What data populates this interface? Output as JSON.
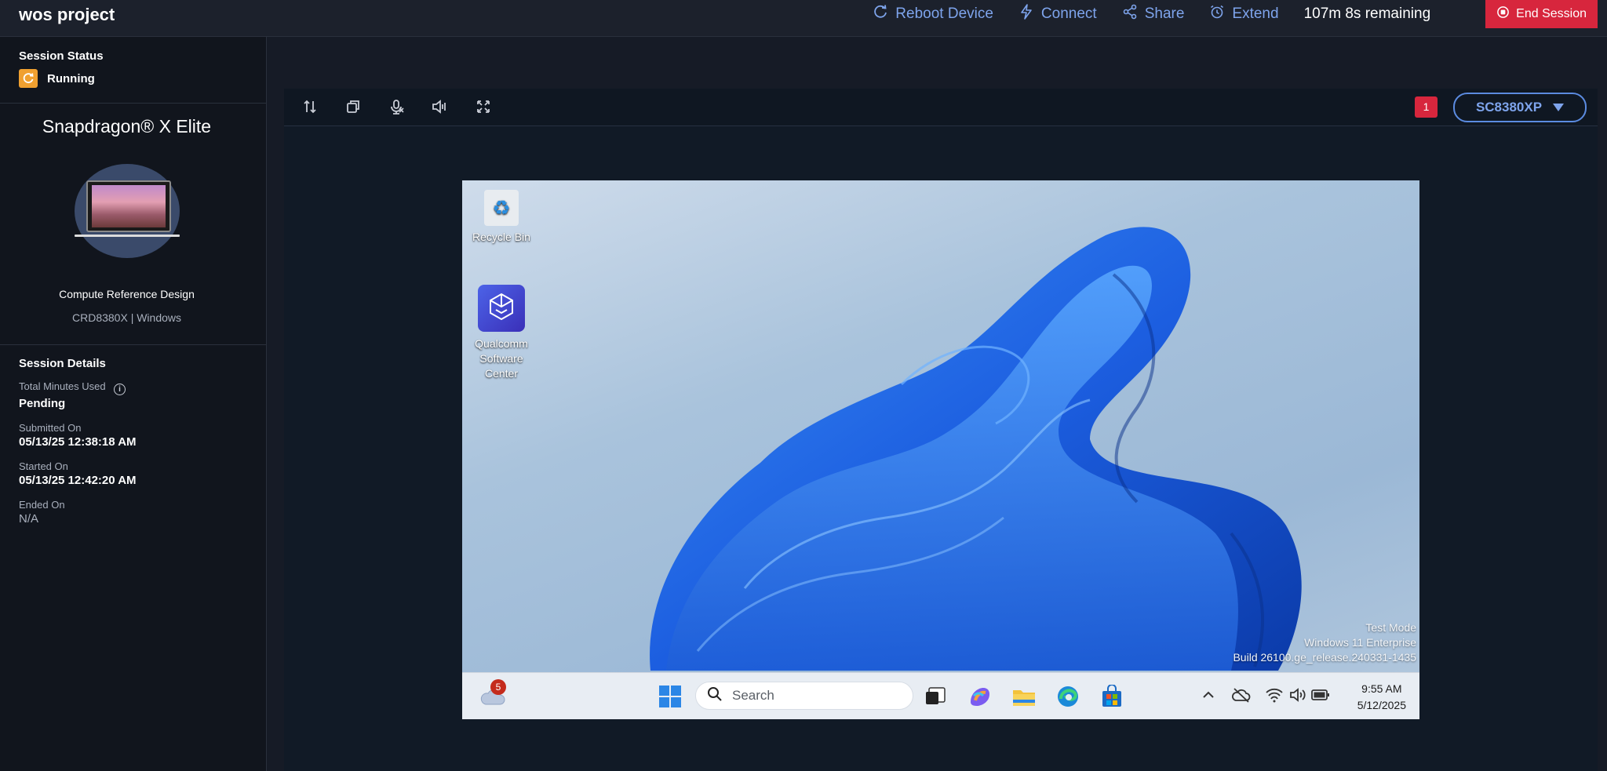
{
  "header": {
    "title": "wos project",
    "actions": {
      "reboot": "Reboot Device",
      "connect": "Connect",
      "share": "Share",
      "extend": "Extend"
    },
    "remaining": "107m 8s remaining",
    "end_session": "End Session"
  },
  "sidebar": {
    "status_label": "Session Status",
    "status_value": "Running",
    "device_title": "Snapdragon® X Elite",
    "device_name": "Compute Reference Design",
    "device_sub": "CRD8380X | Windows",
    "details_title": "Session Details",
    "details": {
      "total_minutes_label": "Total Minutes Used",
      "total_minutes_value": "Pending",
      "submitted_label": "Submitted On",
      "submitted_value": "05/13/25 12:38:18 AM",
      "started_label": "Started On",
      "started_value": "05/13/25 12:42:20 AM",
      "ended_label": "Ended On",
      "ended_value": "N/A"
    }
  },
  "viewer": {
    "badge_count": "1",
    "device_select": "SC8380XP",
    "toolbar_icons": [
      "swap-arrows-icon",
      "copy-icon",
      "mic-off-icon",
      "speaker-icon",
      "fullscreen-icon"
    ]
  },
  "remote_desktop": {
    "icons": {
      "recycle_bin": "Recycle Bin",
      "qualcomm_line1": "Qualcomm",
      "qualcomm_line2": "Software",
      "qualcomm_line3": "Center"
    },
    "watermark": {
      "line1": "Test Mode",
      "line2": "Windows 11 Enterprise",
      "line3": "Build 26100.ge_release.240331-1435"
    },
    "taskbar": {
      "weather_badge": "5",
      "search_placeholder": "Search",
      "time": "9:55 AM",
      "date": "5/12/2025"
    }
  },
  "colors": {
    "accent": "#7ea4ec",
    "danger": "#d7263d",
    "status": "#f0a030"
  }
}
